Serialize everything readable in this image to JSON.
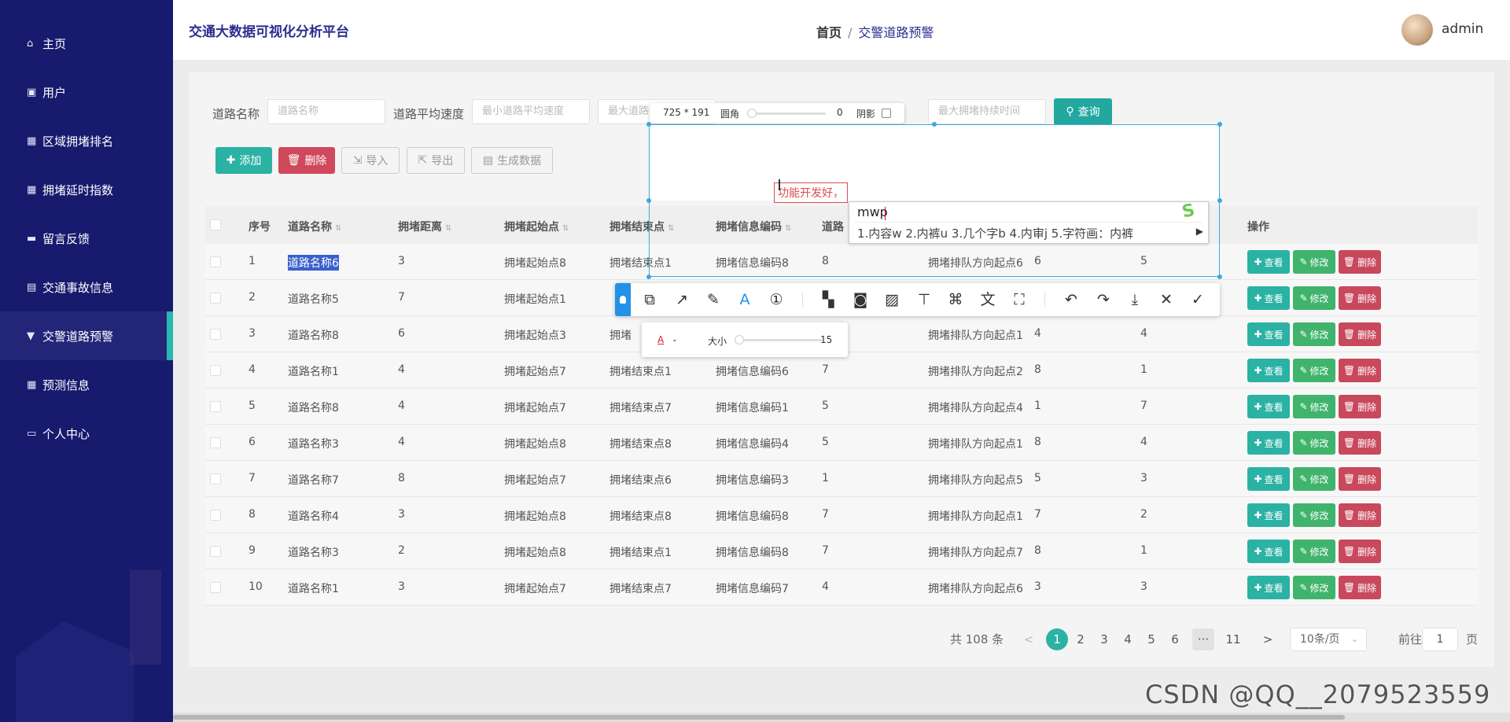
{
  "app": {
    "title": "交通大数据可视化分析平台"
  },
  "breadcrumb": {
    "home": "首页",
    "separator": "/",
    "current": "交警道路预警"
  },
  "user": {
    "name": "admin"
  },
  "sidebar": {
    "items": [
      {
        "label": "主页",
        "icon": "home-icon"
      },
      {
        "label": "用户",
        "icon": "clipboard-icon"
      },
      {
        "label": "区域拥堵排名",
        "icon": "grid-icon"
      },
      {
        "label": "拥堵延时指数",
        "icon": "grid-icon"
      },
      {
        "label": "留言反馈",
        "icon": "briefcase-icon"
      },
      {
        "label": "交通事故信息",
        "icon": "chart-icon"
      },
      {
        "label": "交警道路预警",
        "icon": "pushpin-icon",
        "active": true
      },
      {
        "label": "预测信息",
        "icon": "grid-icon"
      },
      {
        "label": "个人中心",
        "icon": "card-icon"
      }
    ]
  },
  "filters": {
    "road_name_label": "道路名称",
    "road_name_placeholder": "道路名称",
    "avg_speed_label": "道路平均速度",
    "min_speed_placeholder": "最小道路平均速度",
    "max_speed_placeholder": "最大道路平均速度",
    "max_duration_placeholder": "最大拥堵持续时间",
    "search_button": "查询"
  },
  "actions": {
    "add": "添加",
    "delete": "删除",
    "import": "导入",
    "export": "导出",
    "generate": "生成数据"
  },
  "table": {
    "headers": [
      "序号",
      "道路名称",
      "拥堵距离",
      "拥堵起始点",
      "拥堵结束点",
      "拥堵信息编码",
      "道路",
      "操作"
    ],
    "row_buttons": {
      "view": "查看",
      "edit": "修改",
      "delete": "删除"
    },
    "rows": [
      {
        "idx": "1",
        "name": "道路名称6",
        "dist": "3",
        "start": "拥堵起始点8",
        "end": "拥堵结束点1",
        "code": "拥堵信息编码8",
        "c7": "8",
        "dir": "拥堵排队方向起点6",
        "c9": "6",
        "c10": "5"
      },
      {
        "idx": "2",
        "name": "道路名称5",
        "dist": "7",
        "start": "拥堵起始点1",
        "end": "",
        "code": "",
        "c7": "",
        "dir": "",
        "c9": "",
        "c10": ""
      },
      {
        "idx": "3",
        "name": "道路名称8",
        "dist": "6",
        "start": "拥堵起始点3",
        "end": "拥堵",
        "code": "",
        "c7": "",
        "dir": "拥堵排队方向起点1",
        "c9": "4",
        "c10": "4"
      },
      {
        "idx": "4",
        "name": "道路名称1",
        "dist": "4",
        "start": "拥堵起始点7",
        "end": "拥堵结束点1",
        "code": "拥堵信息编码6",
        "c7": "7",
        "dir": "拥堵排队方向起点2",
        "c9": "8",
        "c10": "1"
      },
      {
        "idx": "5",
        "name": "道路名称8",
        "dist": "4",
        "start": "拥堵起始点7",
        "end": "拥堵结束点7",
        "code": "拥堵信息编码1",
        "c7": "5",
        "dir": "拥堵排队方向起点4",
        "c9": "1",
        "c10": "7"
      },
      {
        "idx": "6",
        "name": "道路名称3",
        "dist": "4",
        "start": "拥堵起始点8",
        "end": "拥堵结束点8",
        "code": "拥堵信息编码4",
        "c7": "5",
        "dir": "拥堵排队方向起点1",
        "c9": "8",
        "c10": "4"
      },
      {
        "idx": "7",
        "name": "道路名称7",
        "dist": "8",
        "start": "拥堵起始点7",
        "end": "拥堵结束点6",
        "code": "拥堵信息编码3",
        "c7": "1",
        "dir": "拥堵排队方向起点5",
        "c9": "5",
        "c10": "3"
      },
      {
        "idx": "8",
        "name": "道路名称4",
        "dist": "3",
        "start": "拥堵起始点8",
        "end": "拥堵结束点8",
        "code": "拥堵信息编码8",
        "c7": "7",
        "dir": "拥堵排队方向起点1",
        "c9": "7",
        "c10": "2"
      },
      {
        "idx": "9",
        "name": "道路名称3",
        "dist": "2",
        "start": "拥堵起始点8",
        "end": "拥堵结束点1",
        "code": "拥堵信息编码8",
        "c7": "7",
        "dir": "拥堵排队方向起点7",
        "c9": "8",
        "c10": "1"
      },
      {
        "idx": "10",
        "name": "道路名称1",
        "dist": "3",
        "start": "拥堵起始点7",
        "end": "拥堵结束点7",
        "code": "拥堵信息编码7",
        "c7": "4",
        "dir": "拥堵排队方向起点6",
        "c9": "3",
        "c10": "3"
      }
    ]
  },
  "pagination": {
    "total_text": "共 108 条",
    "prev": "<",
    "pages": [
      "1",
      "2",
      "3",
      "4",
      "5",
      "6"
    ],
    "ellipsis": "···",
    "last_page": "11",
    "next": ">",
    "page_size": "10条/页",
    "goto_prefix": "前往",
    "goto_value": "1",
    "goto_suffix": "页"
  },
  "screenshot_tool": {
    "size_text": "725 * 191",
    "corner_label": "圆角",
    "corner_value": "0",
    "shadow_label": "阴影",
    "text_annotation": "功能开发好，",
    "ime_input": "mwp",
    "ime_candidates": "1.内容w  2.内裤u  3.几个字b  4.内审j  5.字符画：内裤",
    "size_label": "大小",
    "size_value": "15",
    "tools": [
      "grip-icon",
      "shape-icon",
      "arrow-icon",
      "pen-icon",
      "text-icon",
      "number-icon",
      "mosaic-icon",
      "blur-icon",
      "hatch-icon",
      "pin-icon",
      "ocr-icon",
      "translate-icon",
      "capture-text-icon",
      "undo-icon",
      "redo-icon",
      "download-icon",
      "close-icon",
      "confirm-icon"
    ]
  },
  "watermark": "CSDN @QQ__2079523559",
  "colors": {
    "sidebar": "#181a6e",
    "accent": "#2bb2a4",
    "danger": "#d0485c",
    "success": "#40b46c",
    "highlight": "#2391e6"
  }
}
